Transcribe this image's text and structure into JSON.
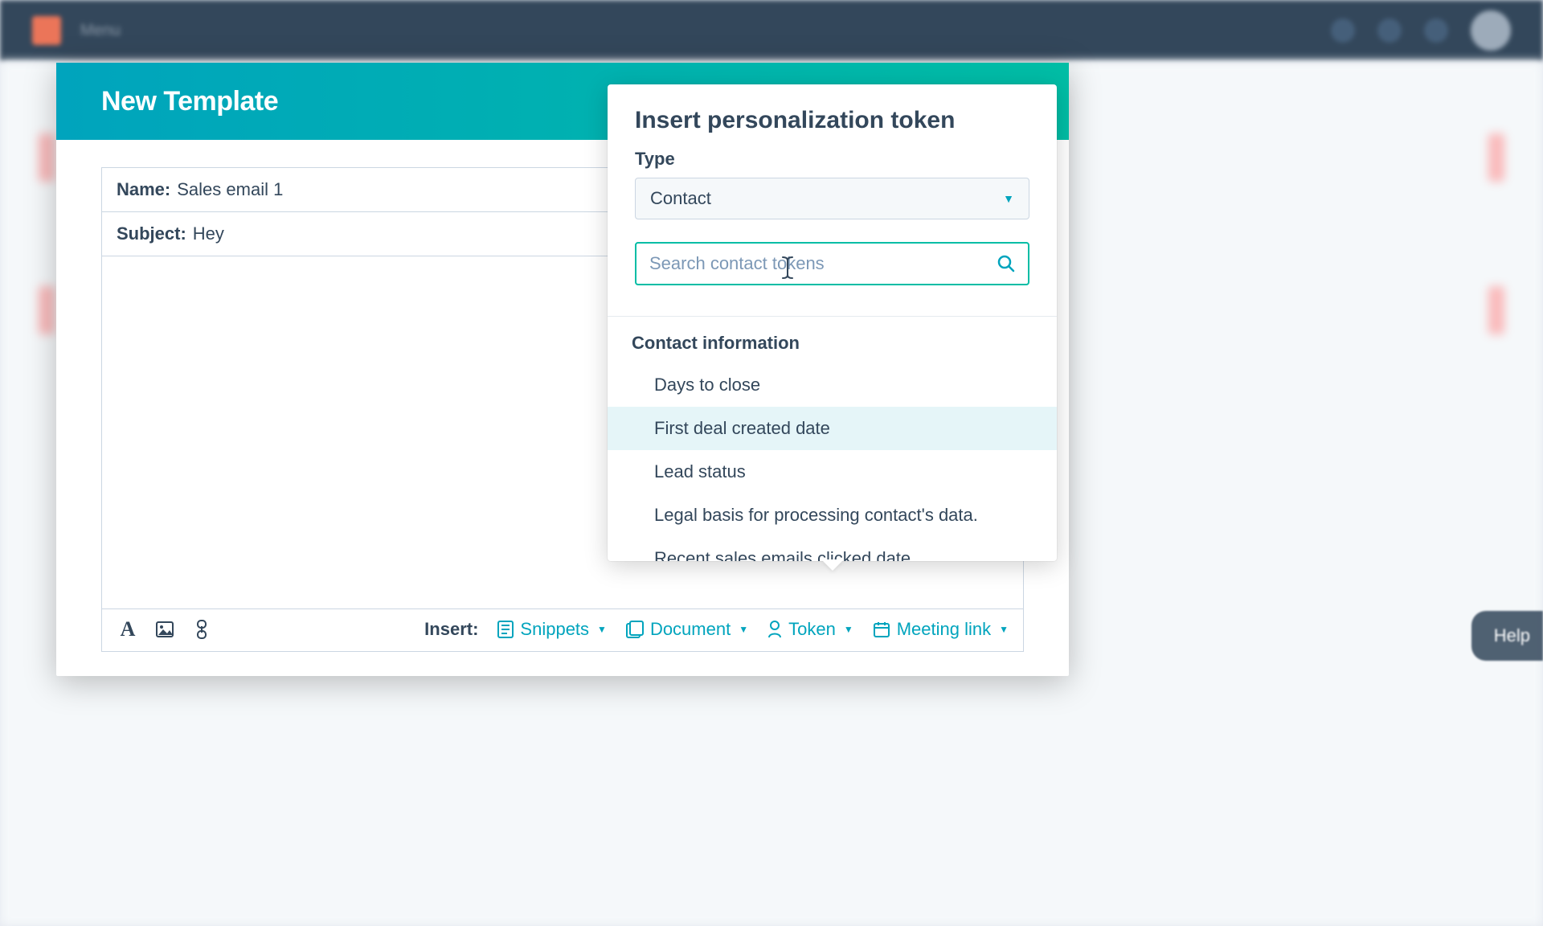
{
  "nav": {
    "menu_text": "Menu"
  },
  "modal": {
    "title": "New Template",
    "name_label": "Name:",
    "name_value": "Sales email 1",
    "subject_label": "Subject:",
    "subject_value": "Hey"
  },
  "toolbar": {
    "insert_label": "Insert:",
    "snippets": "Snippets",
    "document": "Document",
    "token": "Token",
    "meeting": "Meeting link"
  },
  "popover": {
    "title": "Insert personalization token",
    "type_label": "Type",
    "type_value": "Contact",
    "search_placeholder": "Search contact tokens",
    "section_label": "Contact information",
    "tokens": [
      "Days to close",
      "First deal created date",
      "Lead status",
      "Legal basis for processing contact's data.",
      "Recent sales emails clicked date"
    ],
    "hovered_index": 1
  },
  "help": "Help"
}
